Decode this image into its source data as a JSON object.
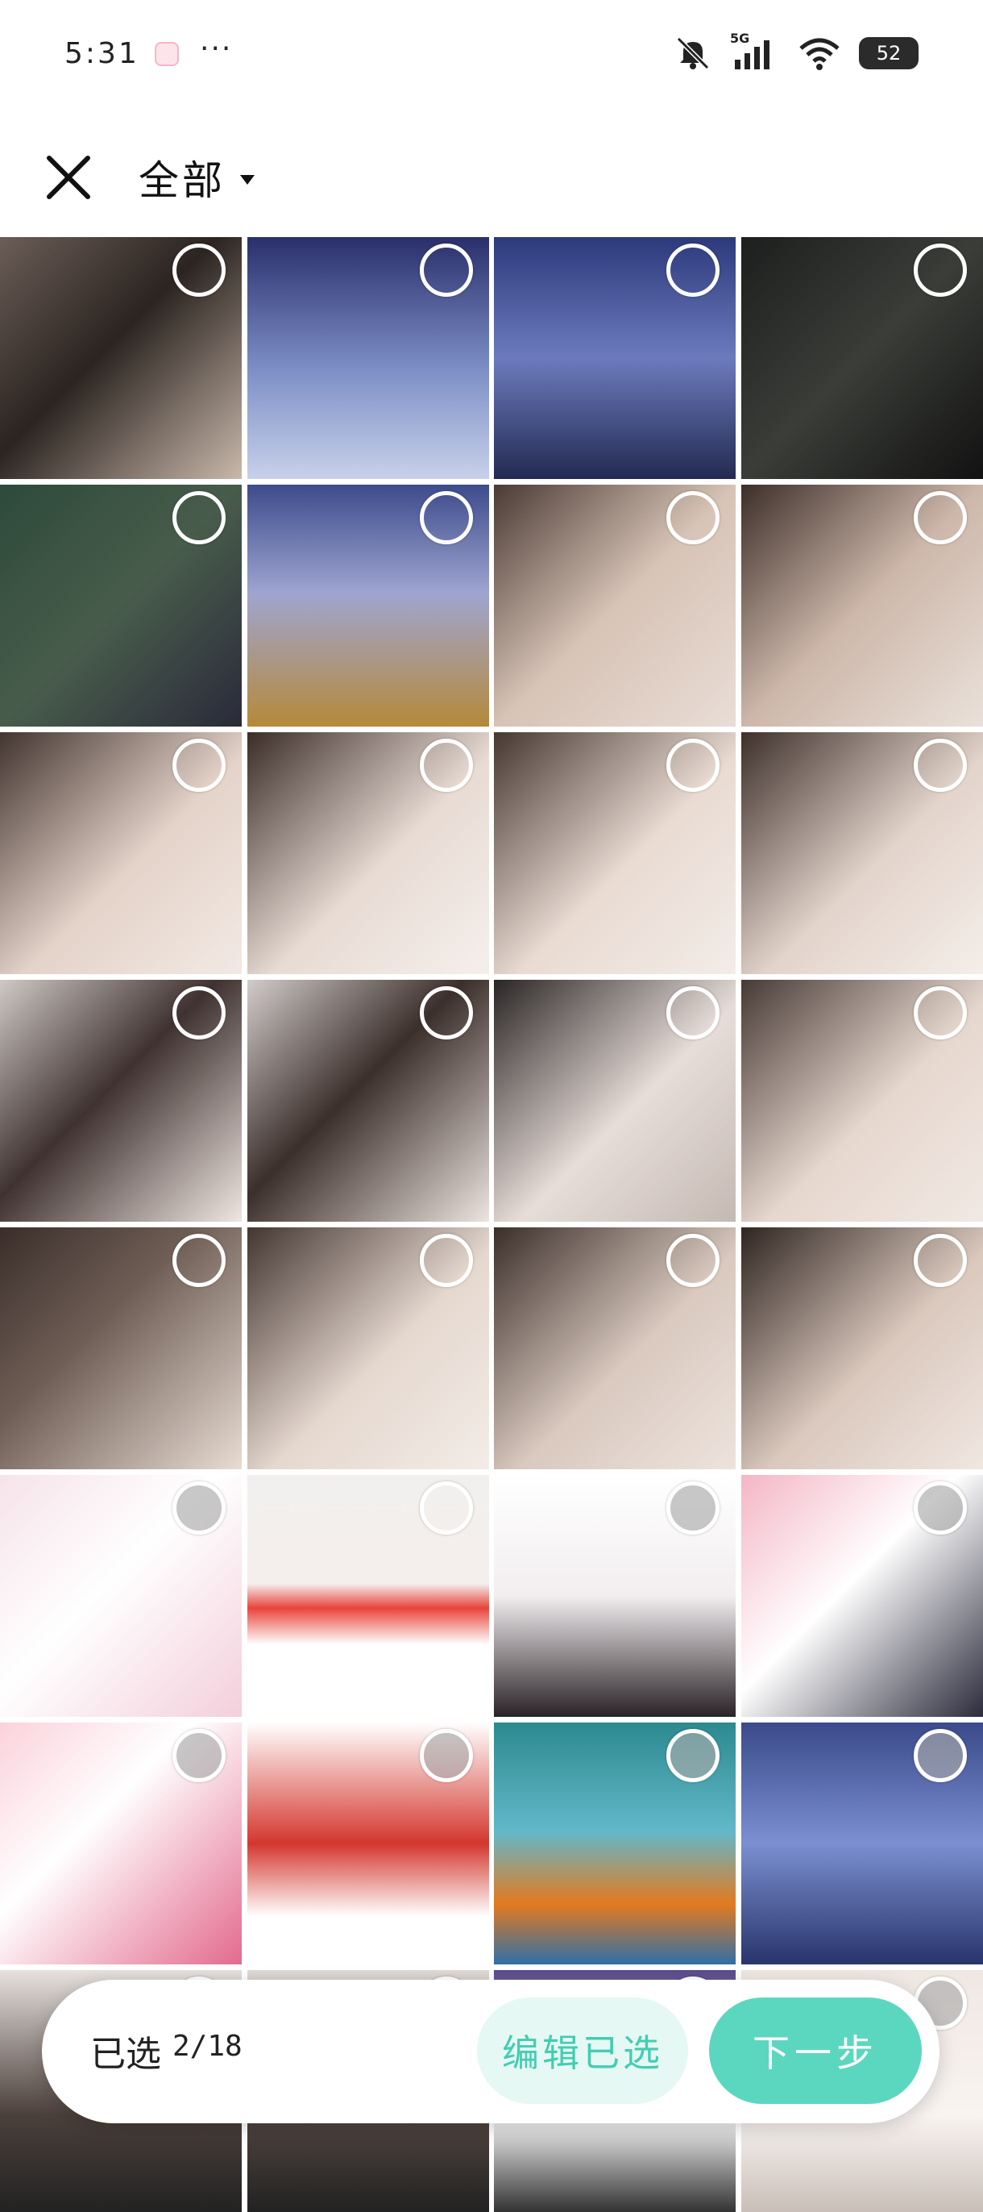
{
  "status_bar": {
    "time": "5:31",
    "more": "···",
    "network": "5G",
    "battery": "52"
  },
  "header": {
    "album_title": "全部"
  },
  "grid": {
    "tiles": [
      {
        "desc": "selfie-couple",
        "bg": "linear-gradient(135deg,#6b5d57,#2b2420 45%,#c9b8ab)"
      },
      {
        "desc": "game-character-snow",
        "bg": "linear-gradient(180deg,#2a2f6b,#7d8fc6 55%,#c8d1ea)"
      },
      {
        "desc": "game-mvp-bunny",
        "bg": "linear-gradient(180deg,#2c3a7c,#6c7bbd 50%,#232a52)"
      },
      {
        "desc": "dark-room",
        "bg": "linear-gradient(135deg,#1d1f1e,#3a3d38 50%,#121212)"
      },
      {
        "desc": "game-map",
        "bg": "linear-gradient(135deg,#2d4a3a,#485c4b 50%,#2a2a3a)"
      },
      {
        "desc": "vs-screen",
        "bg": "linear-gradient(180deg,#3c4b8c,#9fa5d0 45%,#b5893a)"
      },
      {
        "desc": "selfie-1",
        "bg": "linear-gradient(135deg,#4a3a34,#d7c3b6 50%,#e9ddd6)"
      },
      {
        "desc": "selfie-2",
        "bg": "linear-gradient(135deg,#3c2e29,#cdb7aa 50%,#eae1da)"
      },
      {
        "desc": "selfie-3",
        "bg": "linear-gradient(135deg,#42342f,#e4d3c9 55%,#f2e9e4)"
      },
      {
        "desc": "selfie-4",
        "bg": "linear-gradient(135deg,#3a2d28,#e8dbd4 55%,#f5efeb)"
      },
      {
        "desc": "selfie-5",
        "bg": "linear-gradient(135deg,#463731,#e9dbd2 55%,#f3ece8)"
      },
      {
        "desc": "selfie-6",
        "bg": "linear-gradient(135deg,#3d2f2a,#e3d4cb 55%,#f4eee9)"
      },
      {
        "desc": "selfie-7",
        "bg": "linear-gradient(135deg,#cfc9c6,#3f3230 45%,#efe6e1)"
      },
      {
        "desc": "selfie-8",
        "bg": "linear-gradient(135deg,#d2ccca,#3b2f2b 45%,#ede4df)"
      },
      {
        "desc": "selfie-couple-2",
        "bg": "linear-gradient(135deg,#2a2525,#e7ddd8 55%,#c4b9b3)"
      },
      {
        "desc": "selfie-9",
        "bg": "linear-gradient(135deg,#473934,#e6d7ce 55%,#f1e9e4)"
      },
      {
        "desc": "selfie-sparkle",
        "bg": "linear-gradient(135deg,#3a2e2a,#6e5d55 40%,#e8dcd3)"
      },
      {
        "desc": "selfie-10",
        "bg": "linear-gradient(135deg,#433530,#e5d8cf 55%,#f3ece7)"
      },
      {
        "desc": "selfie-11",
        "bg": "linear-gradient(135deg,#3b2e29,#d9c9bf 55%,#ede3dd)"
      },
      {
        "desc": "selfie-12",
        "bg": "linear-gradient(135deg,#2f2521,#dac8bd 55%,#f0e7e1)"
      },
      {
        "desc": "scribble-note",
        "bg": "linear-gradient(135deg,#f6e3ea,#ffffff 45%,#f3cfdb)"
      },
      {
        "desc": "shopping-ad",
        "bg": "linear-gradient(180deg,#f2f0ee,#f4eeec 45%,#e8443a 55%,#ffffff 70%)"
      },
      {
        "desc": "anime-girl-white",
        "bg": "linear-gradient(180deg,#ffffff,#f2eef0 50%,#2a2226)"
      },
      {
        "desc": "anime-christmas",
        "bg": "linear-gradient(135deg,#f4b6c6,#ffffff 45%,#2b2b3c)"
      },
      {
        "desc": "anime-pink-hair",
        "bg": "linear-gradient(135deg,#fbd2dc,#ffffff 40%,#e36a8e)"
      },
      {
        "desc": "santa-hat",
        "bg": "linear-gradient(180deg,#ffffff,#d3372e 50%,#ffffff 80%)"
      },
      {
        "desc": "goldfish-poster",
        "bg": "linear-gradient(180deg,#2c8a8f,#62b8c9 45%,#e37a1f 75%,#2f6fa8)"
      },
      {
        "desc": "game-result",
        "bg": "linear-gradient(180deg,#3a4a8a,#7b8fd1 50%,#28346b)"
      },
      {
        "desc": "person-partial-1",
        "bg": "linear-gradient(180deg,#e7e1de,#4b403b 60%,#222)"
      },
      {
        "desc": "person-partial-2",
        "bg": "linear-gradient(180deg,#e1dbd7,#514540 60%,#222)"
      },
      {
        "desc": "anime-partial",
        "bg": "linear-gradient(180deg,#5a4a8a,#ffffff 60%,#333)"
      },
      {
        "desc": "product-partial",
        "bg": "linear-gradient(180deg,#efe7e2,#f9f4f1 60%,#c9bfb8)"
      }
    ],
    "selected_indices": []
  },
  "bottom_bar": {
    "selected_label": "已选",
    "selected_count": "2/18",
    "edit_label": "编辑已选",
    "next_label": "下一步"
  },
  "colors": {
    "accent": "#5cd7bf",
    "accent_light": "#e6f8f4",
    "accent_text": "#43cdb1"
  }
}
